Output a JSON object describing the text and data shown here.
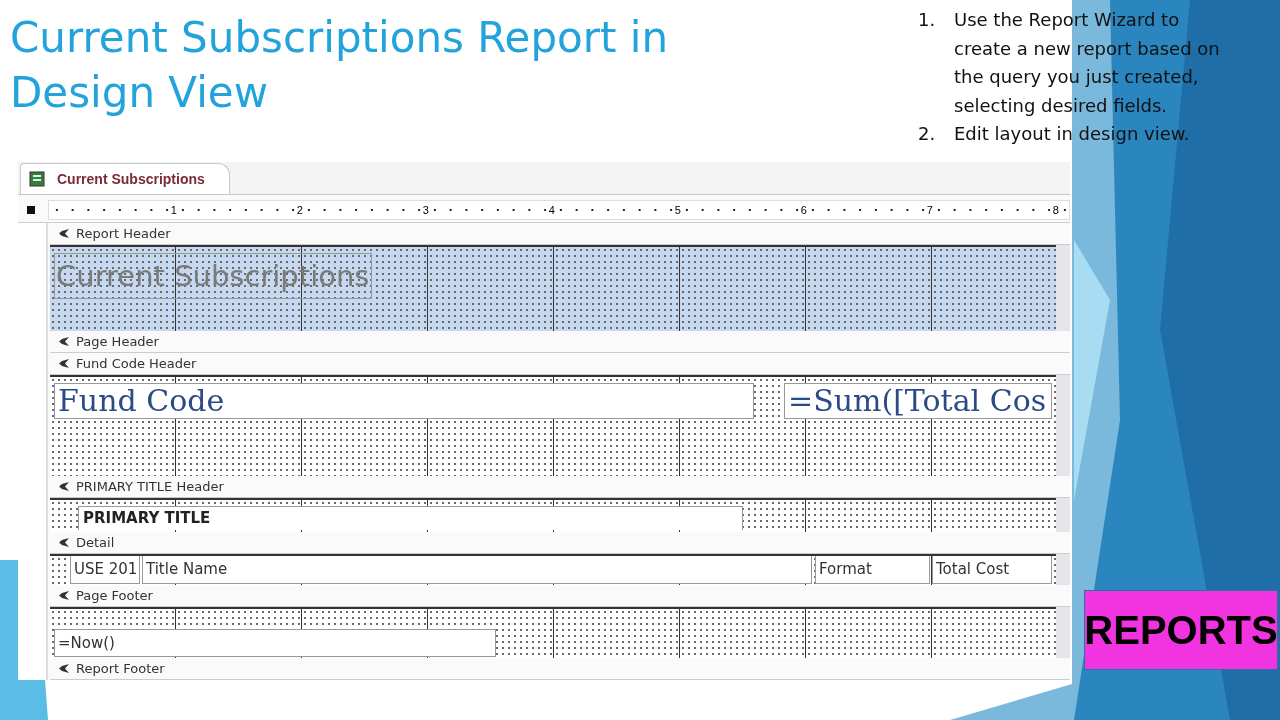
{
  "slide": {
    "title": "Current Subscriptions Report in Design View",
    "steps": [
      {
        "number": "1.",
        "text": "Use the Report Wizard to create a new report based on the query you just created, selecting desired fields."
      },
      {
        "number": "2.",
        "text": "Edit layout in design view."
      }
    ],
    "badge": "REPORTS"
  },
  "window": {
    "tab": {
      "label": "Current Subscriptions",
      "selected": true
    },
    "ruler": [
      "1",
      "2",
      "3",
      "4",
      "5",
      "6",
      "7",
      "8"
    ],
    "sections": [
      {
        "label": "Report Header",
        "kind": "title",
        "controls": [
          "Current Subscriptions"
        ]
      },
      {
        "label": "Page Header",
        "kind": "empty"
      },
      {
        "label": "Fund Code Header",
        "kind": "group",
        "controls": [
          "Fund Code",
          "=Sum([Total Cos"
        ]
      },
      {
        "label": "PRIMARY TITLE Header",
        "kind": "primary",
        "controls": [
          "PRIMARY TITLE"
        ]
      },
      {
        "label": "Detail",
        "kind": "detail",
        "controls": [
          "USE 201",
          "Title Name",
          "Format",
          "Total Cost"
        ]
      },
      {
        "label": "Page Footer",
        "kind": "footer",
        "controls": [
          "=Now()"
        ]
      },
      {
        "label": "Report Footer",
        "kind": "empty"
      }
    ]
  }
}
